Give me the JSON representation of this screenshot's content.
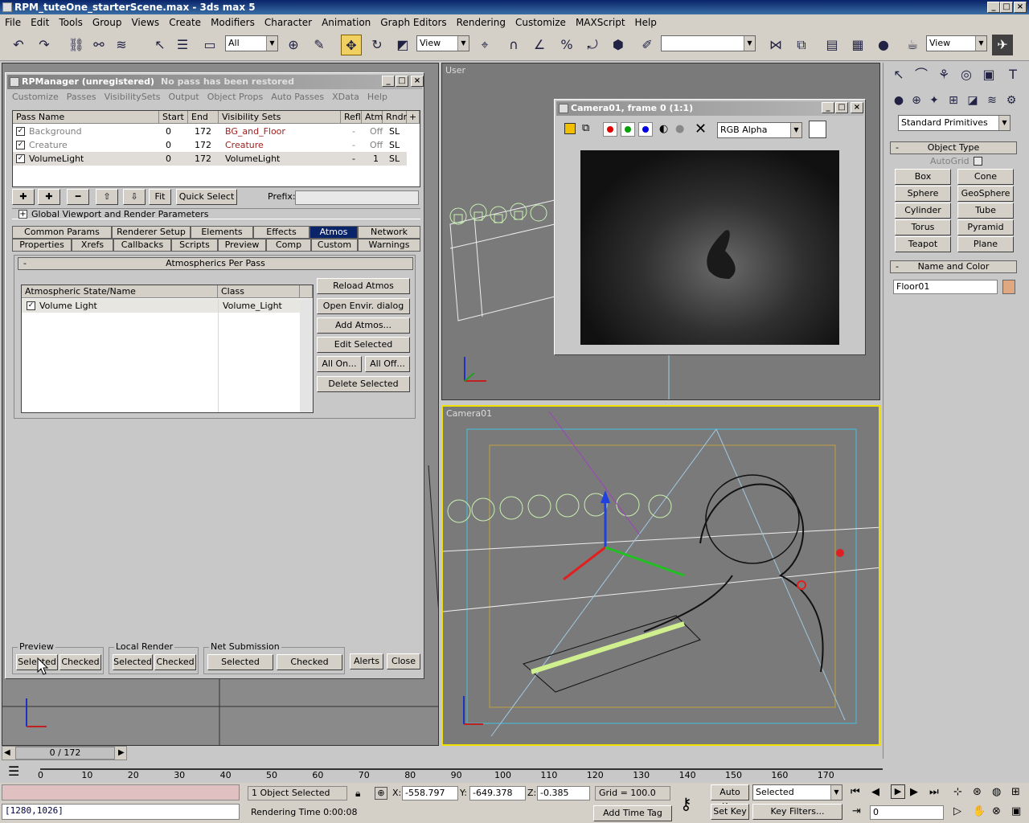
{
  "window": {
    "title": "RPM_tuteOne_starterScene.max - 3ds max 5"
  },
  "menu": [
    "File",
    "Edit",
    "Tools",
    "Group",
    "Views",
    "Create",
    "Modifiers",
    "Character",
    "Animation",
    "Graph Editors",
    "Rendering",
    "Customize",
    "MAXScript",
    "Help"
  ],
  "toolbar": {
    "selection_filter": "All",
    "ref_coord": "View",
    "named_sel": "",
    "view2": "View"
  },
  "viewports": {
    "top_right_label": "User",
    "camera_label": "Camera01"
  },
  "rpm": {
    "title": "RPManager (unregistered)",
    "subtitle": "No pass has been restored",
    "menu": [
      "Customize",
      "Passes",
      "VisibilitySets",
      "Output",
      "Object Props",
      "Auto Passes",
      "XData",
      "Help"
    ],
    "columns": [
      "Pass Name",
      "Start",
      "End",
      "Visibility Sets",
      "Refl",
      "Atm",
      "Rndr"
    ],
    "passes": [
      {
        "name": "Background",
        "start": "0",
        "end": "172",
        "vis": "BG_and_Floor",
        "refl": "-",
        "atm": "Off",
        "rndr": "SL"
      },
      {
        "name": "Creature",
        "start": "0",
        "end": "172",
        "vis": "Creature",
        "refl": "-",
        "atm": "Off",
        "rndr": "SL"
      },
      {
        "name": "VolumeLight",
        "start": "0",
        "end": "172",
        "vis": "VolumeLight",
        "refl": "-",
        "atm": "1",
        "rndr": "SL"
      }
    ],
    "fit_label": "Fit",
    "quick_select": "Quick Select",
    "prefix_label": "Prefix:",
    "global_params": "Global Viewport and Render Parameters",
    "tabs_row1": [
      "Common Params",
      "Renderer Setup",
      "Elements",
      "Effects",
      "Atmos",
      "Network"
    ],
    "tabs_row2": [
      "Properties",
      "Xrefs",
      "Callbacks",
      "Scripts",
      "Preview",
      "Comp",
      "Custom",
      "Warnings"
    ],
    "rollout": "Atmospherics Per Pass",
    "atmos_columns": [
      "Atmospheric State/Name",
      "Class"
    ],
    "atmos_rows": [
      {
        "name": "Volume Light",
        "class": "Volume_Light"
      }
    ],
    "atmos_buttons": [
      "Reload Atmos",
      "Open Envir. dialog",
      "Add Atmos...",
      "Edit Selected",
      "All On...",
      "All Off...",
      "Delete Selected"
    ],
    "preview_group": "Preview",
    "local_group": "Local Render",
    "net_group": "Net Submission",
    "selected": "Selected",
    "checked": "Checked",
    "alerts": "Alerts",
    "close": "Close"
  },
  "render_window": {
    "title": "Camera01, frame 0 (1:1)",
    "channel": "RGB Alpha"
  },
  "command_panel": {
    "dropdown": "Standard Primitives",
    "object_type": "Object Type",
    "autogrid": "AutoGrid",
    "primitives": [
      "Box",
      "Cone",
      "Sphere",
      "GeoSphere",
      "Cylinder",
      "Tube",
      "Torus",
      "Pyramid",
      "Teapot",
      "Plane"
    ],
    "name_color": "Name and Color",
    "object_name": "Floor01",
    "swatch": "#e0a880"
  },
  "timeline": {
    "frame": "0 / 172",
    "ticks": [
      "0",
      "10",
      "20",
      "30",
      "40",
      "50",
      "60",
      "70",
      "80",
      "90",
      "100",
      "110",
      "120",
      "130",
      "140",
      "150",
      "160",
      "170"
    ]
  },
  "status": {
    "coords": "[1280,1026]",
    "selected": "1 Object Selected",
    "rendering_time": "Rendering Time  0:00:08",
    "x_label": "X:",
    "x": "-558.797",
    "y_label": "Y:",
    "y": "-649.378",
    "z_label": "Z:",
    "z": "-0.385",
    "grid": "Grid = 100.0",
    "add_time_tag": "Add Time Tag",
    "auto_key": "Auto Key",
    "set_key": "Set Key",
    "key_mode": "Selected",
    "key_filters": "Key Filters...",
    "frame_field": "0"
  }
}
